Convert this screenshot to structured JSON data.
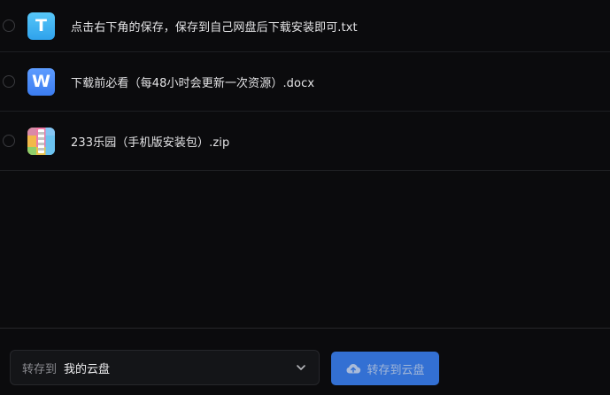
{
  "files": [
    {
      "name": "点击右下角的保存，保存到自己网盘后下载安装即可.txt",
      "icon": "txt-file-icon",
      "icon_letter": "T"
    },
    {
      "name": "下载前必看（每48小时会更新一次资源）.docx",
      "icon": "word-file-icon",
      "icon_letter": "W"
    },
    {
      "name": "233乐园（手机版安装包）.zip",
      "icon": "zip-file-icon"
    }
  ],
  "footer": {
    "dest_label": "转存到",
    "dest_value": "我的云盘",
    "save_label": "转存到云盘"
  },
  "colors": {
    "background": "#0b0b0d",
    "accent": "#3b82f6",
    "txt_icon": "#2fa2ec",
    "word_icon": "#3b7df0"
  }
}
